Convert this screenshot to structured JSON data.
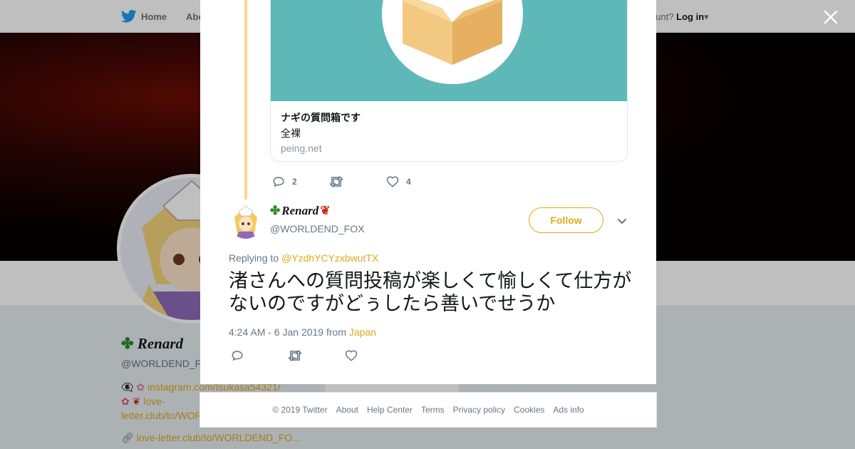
{
  "topnav": {
    "home_label": "Home",
    "about_label": "Abo",
    "login_prefix": "ccount?",
    "login_label": "Log in"
  },
  "profile": {
    "name": "Renard",
    "handle": "@WORLDEND_F",
    "bio_line1": "instagram.com/tsukasa54321/",
    "bio_line2": "love-",
    "bio_line3": "letter.club/to/WOR",
    "url": "love-letter.club/to/WORLDEND_FO…",
    "ads_info": "Ads info"
  },
  "card": {
    "title": "ナギの質問箱です",
    "description": "全裸",
    "domain": "peing.net"
  },
  "parent_tweet": {
    "reply_count": "2",
    "retweet_count": "",
    "like_count": "4"
  },
  "tweet": {
    "display_name": "Renard",
    "handle": "@WORLDEND_FOX",
    "follow_label": "Follow",
    "replying_prefix": "Replying to",
    "replying_to": "@YzdhYCYzxbwutTX",
    "text": "渚さんへの質問投稿が楽しくて愉しくて仕方がないのですがどぅしたら善いでせうか",
    "timestamp": "4:24 AM - 6 Jan 2019",
    "from_label": "from",
    "location": "Japan"
  },
  "footer": {
    "copyright": "© 2019 Twitter",
    "links": [
      "About",
      "Help Center",
      "Terms",
      "Privacy policy",
      "Cookies",
      "Ads info"
    ]
  },
  "colors": {
    "accent": "#e0a81c",
    "thread_line": "#ffd48c",
    "card_bg": "#5fb8b8",
    "twitter_blue": "#1da1f2"
  }
}
